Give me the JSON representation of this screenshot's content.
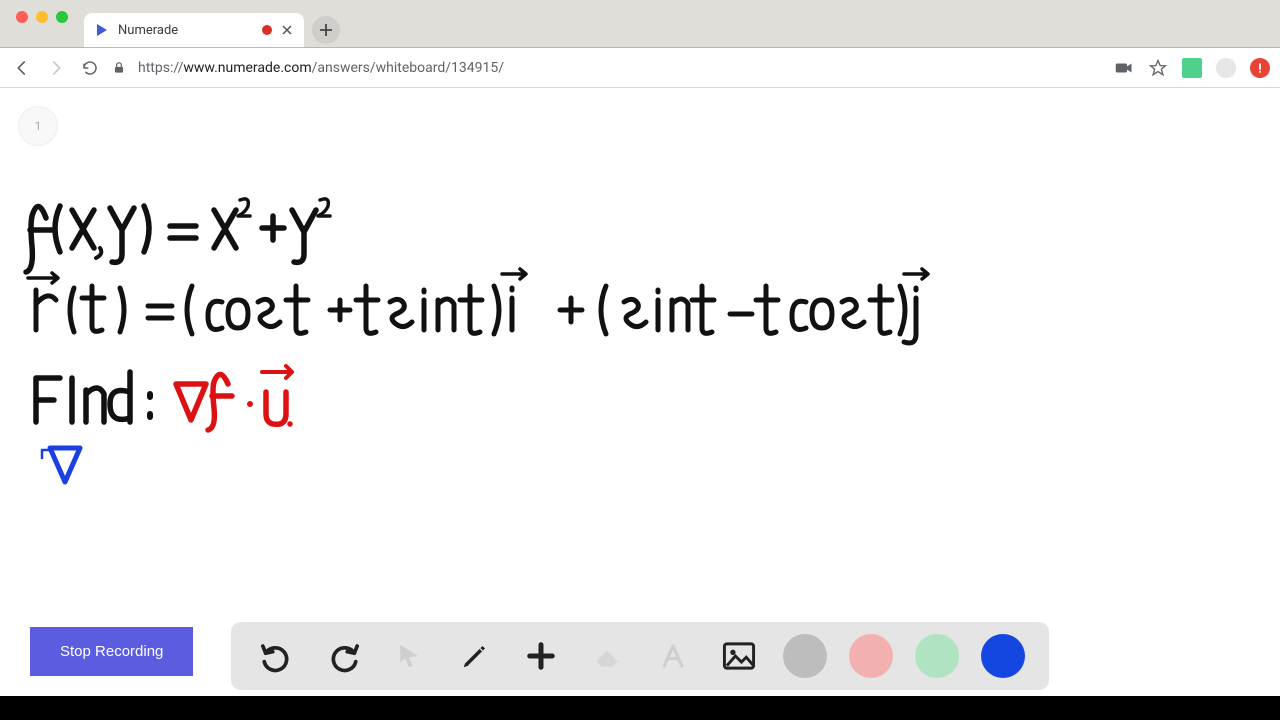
{
  "window": {
    "tab_title": "Numerade",
    "url_protocol": "https://",
    "url_host": "www.numerade.com",
    "url_path": "/answers/whiteboard/134915/"
  },
  "page": {
    "corner_badge": "1"
  },
  "whiteboard": {
    "line1": "f(x,y) =  x²+y²",
    "line2": "r⃗ (t) = (cost + tsint) i⃗  + (sint − tcost) j⃗",
    "line3_label": "Find:",
    "line3_expr": "∇f · u⃗",
    "cursor_symbol": "∇"
  },
  "controls": {
    "stop_label": "Stop Recording"
  },
  "toolbar": {
    "undo": "undo-icon",
    "redo": "redo-icon",
    "pointer": "pointer-icon",
    "pencil": "pencil-icon",
    "add": "add-icon",
    "eraser": "eraser-icon",
    "text": "text-icon",
    "image": "image-icon",
    "colors": {
      "grey": "#bdbdbd",
      "pink": "#f3b0b0",
      "green": "#b0e3c2",
      "blue": "#1446e2"
    }
  }
}
